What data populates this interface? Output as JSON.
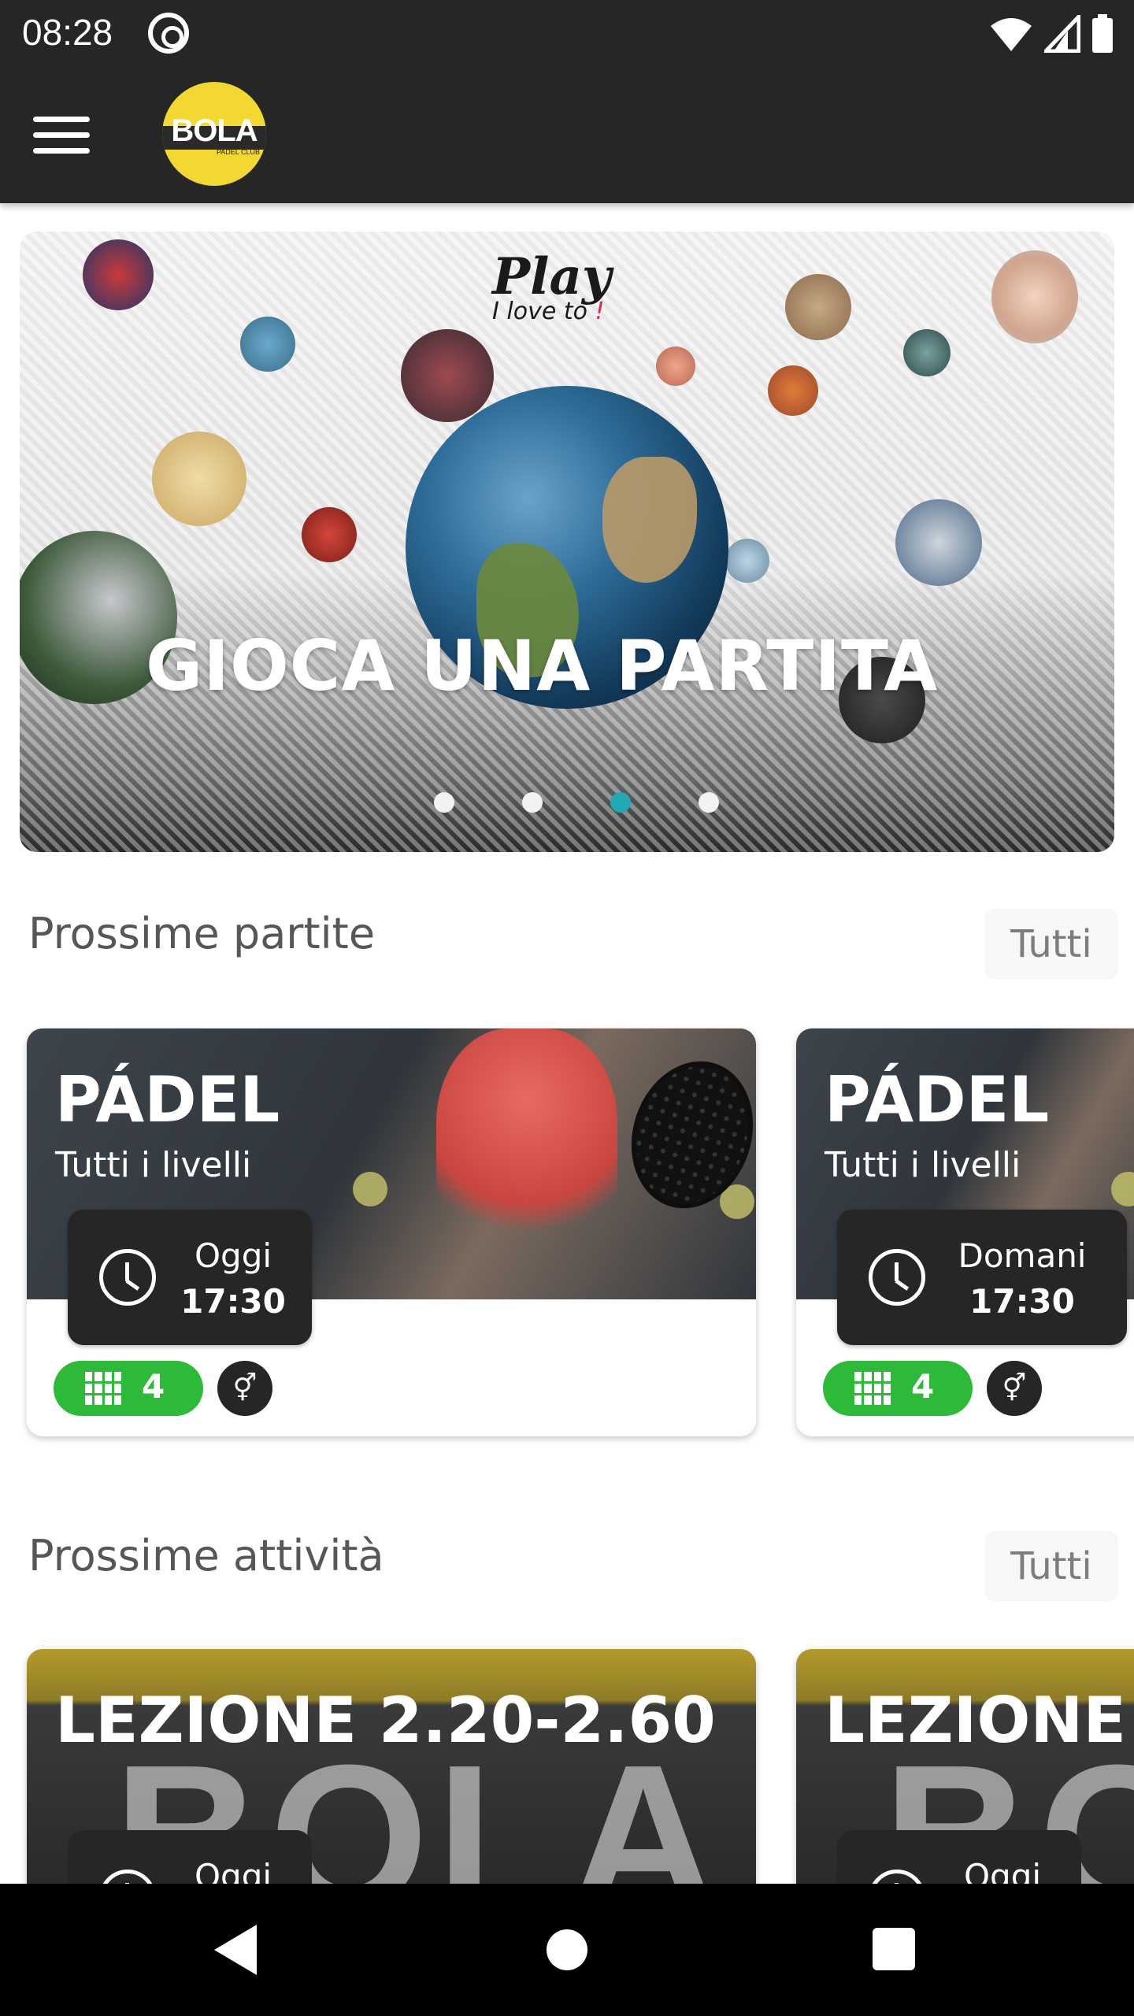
{
  "status_bar": {
    "time": "08:28"
  },
  "banner": {
    "logo_title": "Play",
    "logo_subtitle": "I love to",
    "logo_exclaim": "!",
    "title": "GIOCA UNA PARTITA",
    "dot_count": 4,
    "active_dot": 3
  },
  "app": {
    "logo_text": "BOLA",
    "logo_subtext": "PADEL CLUB"
  },
  "matches_section": {
    "title": "Prossime partite",
    "all_label": "Tutti",
    "cards": [
      {
        "title": "PÁDEL",
        "subtitle": "Tutti i livelli",
        "day": "Oggi",
        "time": "17:30",
        "count": "4",
        "count_color": "#2dba39"
      },
      {
        "title": "PÁDEL",
        "subtitle": "Tutti i livelli",
        "day": "Domani",
        "time": "17:30",
        "count": "4",
        "count_color": "#2dba39"
      }
    ]
  },
  "activities_section": {
    "title": "Prossime attività",
    "all_label": "Tutti",
    "cards": [
      {
        "title": "LEZIONE 2.20-2.60",
        "watermark": "BOLA",
        "day": "Oggi"
      },
      {
        "title": "LEZIONE",
        "watermark": "BO",
        "day": "Oggi"
      }
    ]
  },
  "icons": {
    "menu": "menu-icon",
    "clock": "clock-icon",
    "courts": "grid-icon",
    "gender": "gender-mixed-icon",
    "nav_back": "back-triangle-icon",
    "nav_home": "home-circle-icon",
    "nav_recent": "recent-square-icon"
  },
  "colors": {
    "header_bg": "#262626",
    "accent_teal": "#1fa9b5",
    "badge_green": "#2dba39",
    "logo_yellow": "#f3d832"
  }
}
